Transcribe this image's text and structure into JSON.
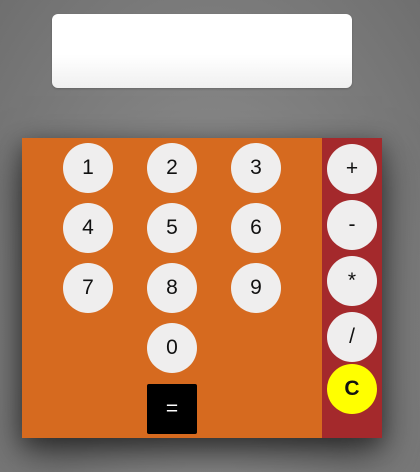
{
  "display": {
    "value": ""
  },
  "digits": [
    "1",
    "2",
    "3",
    "4",
    "5",
    "6",
    "7",
    "8",
    "9",
    "0"
  ],
  "operators": [
    "+",
    "-",
    "*",
    "/"
  ],
  "clear_label": "C",
  "equals_label": "=",
  "colors": {
    "keypad_bg": "#d66a1f",
    "operator_bg": "#a4292c",
    "key_bg": "#efeeee",
    "clear_bg": "#ffff00",
    "equals_bg": "#000000"
  }
}
